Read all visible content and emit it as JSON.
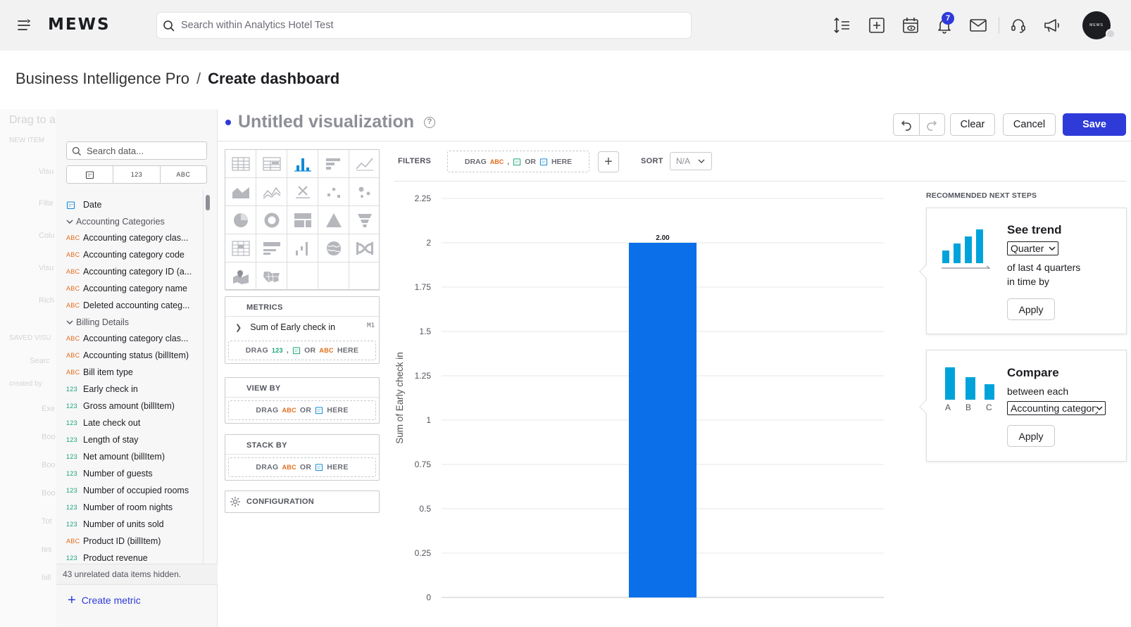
{
  "app": {
    "logo": "MEWS",
    "search_placeholder": "Search within Analytics Hotel Test",
    "notification_count": "7",
    "avatar_text": "MEWS"
  },
  "breadcrumb": {
    "parent": "Business Intelligence Pro",
    "separator": "/",
    "current": "Create dashboard"
  },
  "ghost_panel": {
    "items": [
      "Drag to a",
      "NEW ITEM",
      "Visu",
      "Filte",
      "Colu",
      "Visu",
      "Rich",
      "SAVED VISU",
      "Searc",
      "created by",
      "Exe",
      "Boo",
      "Boo",
      "Boo",
      "Tot",
      "tes",
      "bill"
    ]
  },
  "data_panel": {
    "search_placeholder": "Search data...",
    "type_filters": [
      "",
      "123",
      "ABC"
    ],
    "rows": [
      {
        "type": "date",
        "label": "Date"
      },
      {
        "type": "group",
        "label": "Accounting Categories"
      },
      {
        "type": "abc",
        "label": "Accounting category clas..."
      },
      {
        "type": "abc",
        "label": "Accounting category code"
      },
      {
        "type": "abc",
        "label": "Accounting category ID (a..."
      },
      {
        "type": "abc",
        "label": "Accounting category name"
      },
      {
        "type": "abc",
        "label": "Deleted accounting categ..."
      },
      {
        "type": "group",
        "label": "Billing Details"
      },
      {
        "type": "abc",
        "label": "Accounting category clas..."
      },
      {
        "type": "abc",
        "label": "Accounting status (billItem)"
      },
      {
        "type": "abc",
        "label": "Bill item type"
      },
      {
        "type": "num",
        "label": "Early check in"
      },
      {
        "type": "num",
        "label": "Gross amount (billItem)"
      },
      {
        "type": "num",
        "label": "Late check out"
      },
      {
        "type": "num",
        "label": "Length of stay"
      },
      {
        "type": "num",
        "label": "Net amount (billItem)"
      },
      {
        "type": "num",
        "label": "Number of guests"
      },
      {
        "type": "num",
        "label": "Number of occupied rooms"
      },
      {
        "type": "num",
        "label": "Number of room nights"
      },
      {
        "type": "num",
        "label": "Number of units sold"
      },
      {
        "type": "abc",
        "label": "Product ID (billItem)"
      },
      {
        "type": "num",
        "label": "Product revenue"
      }
    ],
    "type_tags": {
      "abc": "ABC",
      "num": "123"
    },
    "hidden_note": "43 unrelated data items hidden.",
    "create_metric": "Create metric"
  },
  "visualization": {
    "title": "Untitled visualization",
    "help": "?",
    "buttons": {
      "clear": "Clear",
      "cancel": "Cancel",
      "save": "Save"
    }
  },
  "buckets": {
    "metrics_title": "METRICS",
    "metric_item": "Sum of Early check in",
    "metric_tag": "M1",
    "drag": "DRAG",
    "or": "OR",
    "here": "HERE",
    "comma": ",",
    "abc": "ABC",
    "num": "123",
    "view_by_title": "VIEW BY",
    "stack_by_title": "STACK BY",
    "configuration": "CONFIGURATION"
  },
  "filters": {
    "label": "FILTERS",
    "sort_label": "SORT",
    "sort_value": "N/A",
    "add": "+"
  },
  "chart_data": {
    "type": "bar",
    "categories": [
      ""
    ],
    "values": [
      2
    ],
    "data_labels": [
      "2.00"
    ],
    "ylabel": "Sum of Early check in",
    "xlabel": "",
    "ylim": [
      0,
      2.25
    ],
    "yticks": [
      "0",
      "0.25",
      "0.5",
      "0.75",
      "1",
      "1.25",
      "1.5",
      "1.75",
      "2",
      "2.25"
    ],
    "bar_color": "#0a6fe8",
    "grid": true
  },
  "recommended": {
    "title": "RECOMMENDED NEXT STEPS",
    "trend": {
      "heading": "See trend",
      "select": "Quarter",
      "line1": "of last 4 quarters",
      "line2": "in time by",
      "apply": "Apply"
    },
    "compare": {
      "heading": "Compare",
      "line1": "between each",
      "select": "Accounting category",
      "apply": "Apply",
      "letters": [
        "A",
        "B",
        "C"
      ]
    },
    "accent_color": "#00a3d9"
  }
}
